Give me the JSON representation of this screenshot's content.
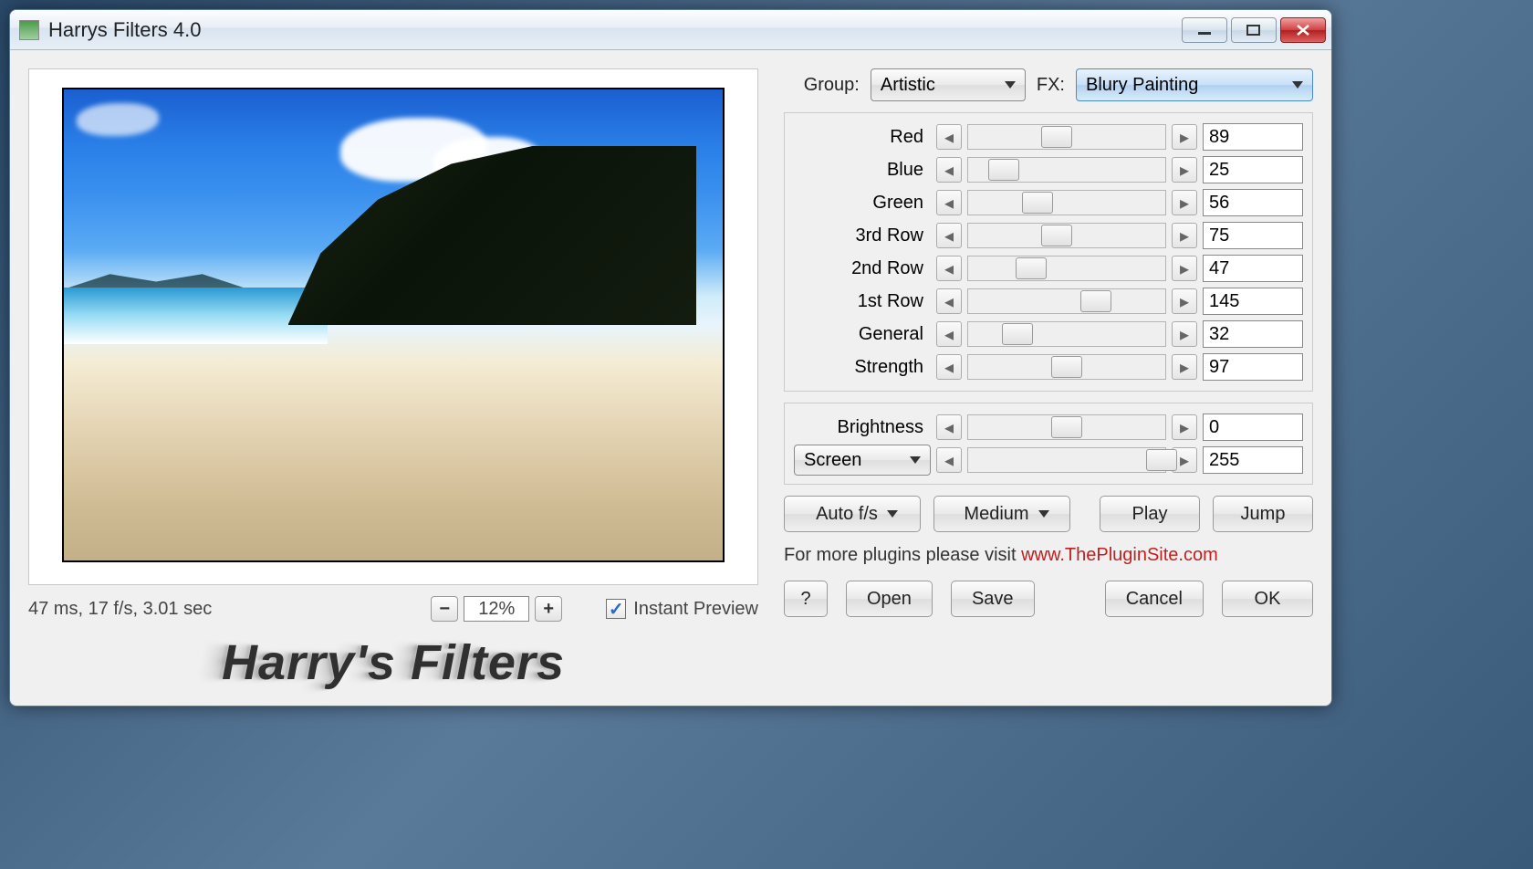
{
  "window": {
    "title": "Harrys Filters 4.0"
  },
  "top": {
    "group_label": "Group:",
    "group_value": "Artistic",
    "fx_label": "FX:",
    "fx_value": "Blury Painting"
  },
  "params": [
    {
      "label": "Red",
      "value": "89",
      "pct": 45
    },
    {
      "label": "Blue",
      "value": "25",
      "pct": 18
    },
    {
      "label": "Green",
      "value": "56",
      "pct": 35
    },
    {
      "label": "3rd Row",
      "value": "75",
      "pct": 45
    },
    {
      "label": "2nd Row",
      "value": "47",
      "pct": 32
    },
    {
      "label": "1st Row",
      "value": "145",
      "pct": 65
    },
    {
      "label": "General",
      "value": "32",
      "pct": 25
    },
    {
      "label": "Strength",
      "value": "97",
      "pct": 50
    }
  ],
  "extra": {
    "brightness_label": "Brightness",
    "brightness_value": "0",
    "brightness_pct": 50,
    "blend_mode": "Screen",
    "blend_value": "255",
    "blend_pct": 98
  },
  "anim": {
    "auto": "Auto f/s",
    "speed": "Medium",
    "play": "Play",
    "jump": "Jump"
  },
  "status": {
    "timing": "47 ms, 17 f/s, 3.01 sec",
    "zoom": "12%",
    "instant_preview": "Instant Preview"
  },
  "logo": "Harry's Filters",
  "footer": {
    "plugins_text": "For more plugins please visit ",
    "plugins_link": "www.ThePluginSite.com",
    "help": "?",
    "open": "Open",
    "save": "Save",
    "cancel": "Cancel",
    "ok": "OK"
  }
}
